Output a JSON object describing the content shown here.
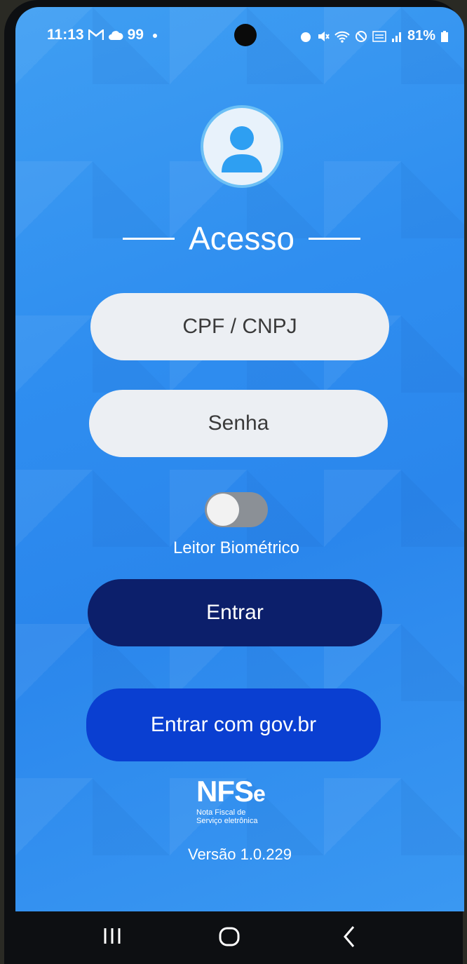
{
  "status": {
    "time": "11:13",
    "badge_count": "99",
    "battery": "81%"
  },
  "icons": {
    "status_left": [
      "gmail-icon",
      "cloud-icon"
    ],
    "status_right": [
      "alarm-icon",
      "mute-icon",
      "wifi-icon",
      "do-not-disturb-icon",
      "volte-icon",
      "signal-icon",
      "battery-icon"
    ],
    "avatar": "user-avatar-icon"
  },
  "login": {
    "title": "Acesso",
    "cpf_placeholder": "CPF / CNPJ",
    "password_placeholder": "Senha",
    "biometric_label": "Leitor Biométrico",
    "biometric_enabled": false,
    "submit_label": "Entrar",
    "govbr_label": "Entrar com gov.br"
  },
  "brand": {
    "logo_text": "NFS",
    "logo_suffix": "e",
    "logo_line1": "Nota Fiscal de",
    "logo_line2": "Serviço eletrônica",
    "version": "Versão 1.0.229"
  },
  "colors": {
    "background": "#2f8ef0",
    "primary_button": "#0c1f6b",
    "govbr_button": "#0a3fd1",
    "field_bg": "#eceff3"
  }
}
